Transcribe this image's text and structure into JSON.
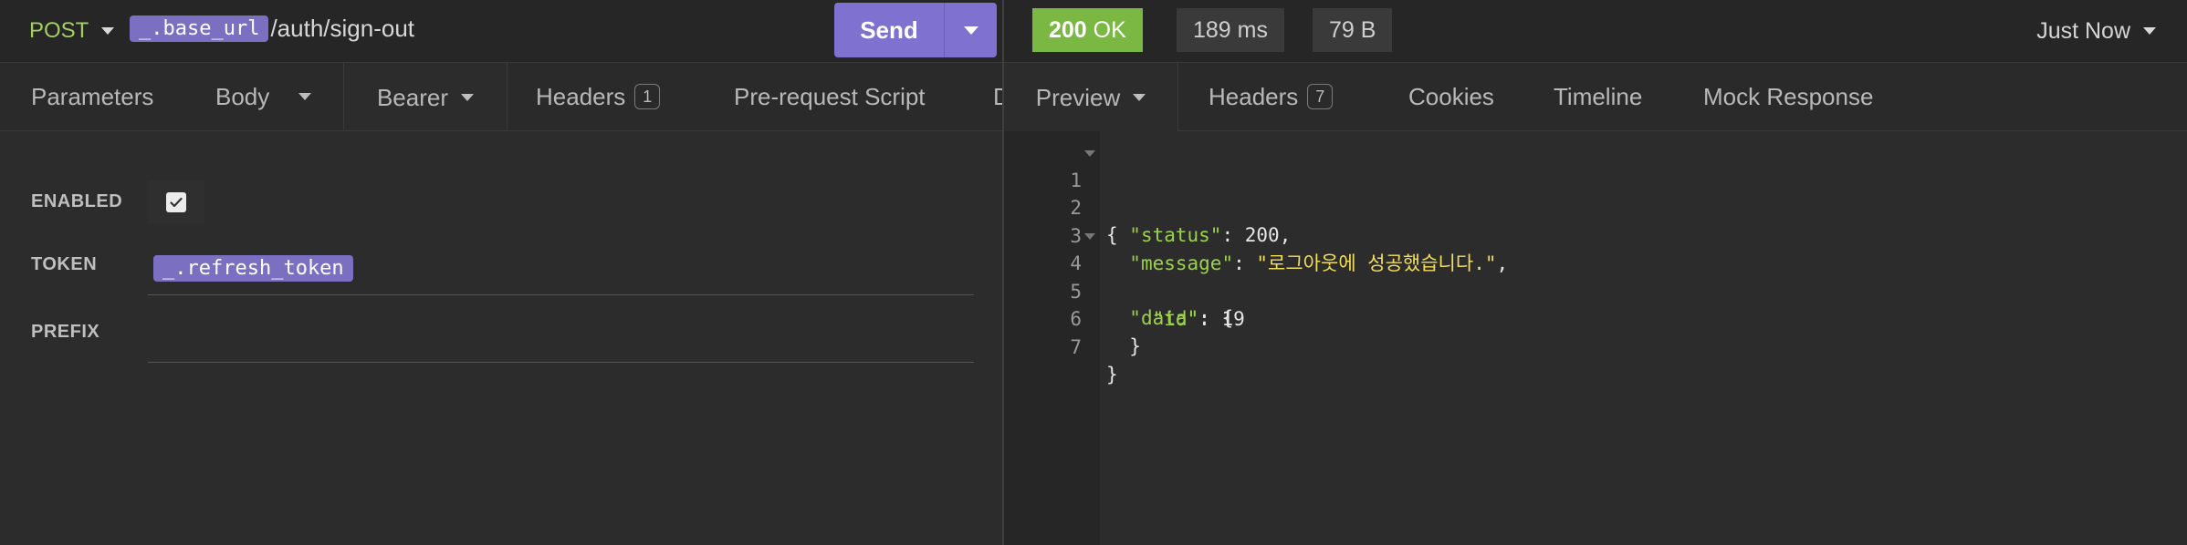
{
  "request": {
    "method": "POST",
    "url_var": "_.base_url",
    "url_path": "/auth/sign-out",
    "send_label": "Send"
  },
  "request_tabs": [
    {
      "label": "Parameters"
    },
    {
      "label": "Body"
    },
    {
      "label": "Bearer"
    },
    {
      "label": "Headers",
      "badge": "1"
    },
    {
      "label": "Pre-request Script"
    },
    {
      "label": "D"
    }
  ],
  "auth": {
    "enabled_label": "ENABLED",
    "enabled": true,
    "token_label": "TOKEN",
    "token_var": "_.refresh_token",
    "prefix_label": "PREFIX",
    "prefix_value": ""
  },
  "response": {
    "status_code": "200",
    "status_text": "OK",
    "time": "189 ms",
    "size": "79 B",
    "history_label": "Just Now"
  },
  "response_tabs": [
    {
      "label": "Preview"
    },
    {
      "label": "Headers",
      "badge": "7"
    },
    {
      "label": "Cookies"
    },
    {
      "label": "Timeline"
    },
    {
      "label": "Mock Response"
    }
  ],
  "editor": {
    "lines": [
      {
        "num": "1",
        "fold": true
      },
      {
        "num": "2"
      },
      {
        "num": "3"
      },
      {
        "num": "4",
        "fold": true
      },
      {
        "num": "5"
      },
      {
        "num": "6"
      },
      {
        "num": "7"
      }
    ],
    "body": {
      "status_key": "\"status\"",
      "status_val": "200",
      "message_key": "\"message\"",
      "message_val": "\"로그아웃에 성공했습니다.\"",
      "data_key": "\"data\"",
      "id_key": "\"id\"",
      "id_val": "19"
    }
  },
  "colors": {
    "accent": "#7e71cf",
    "success": "#7bb843",
    "json_key": "#9bd24c",
    "json_string": "#f2dd5c"
  }
}
